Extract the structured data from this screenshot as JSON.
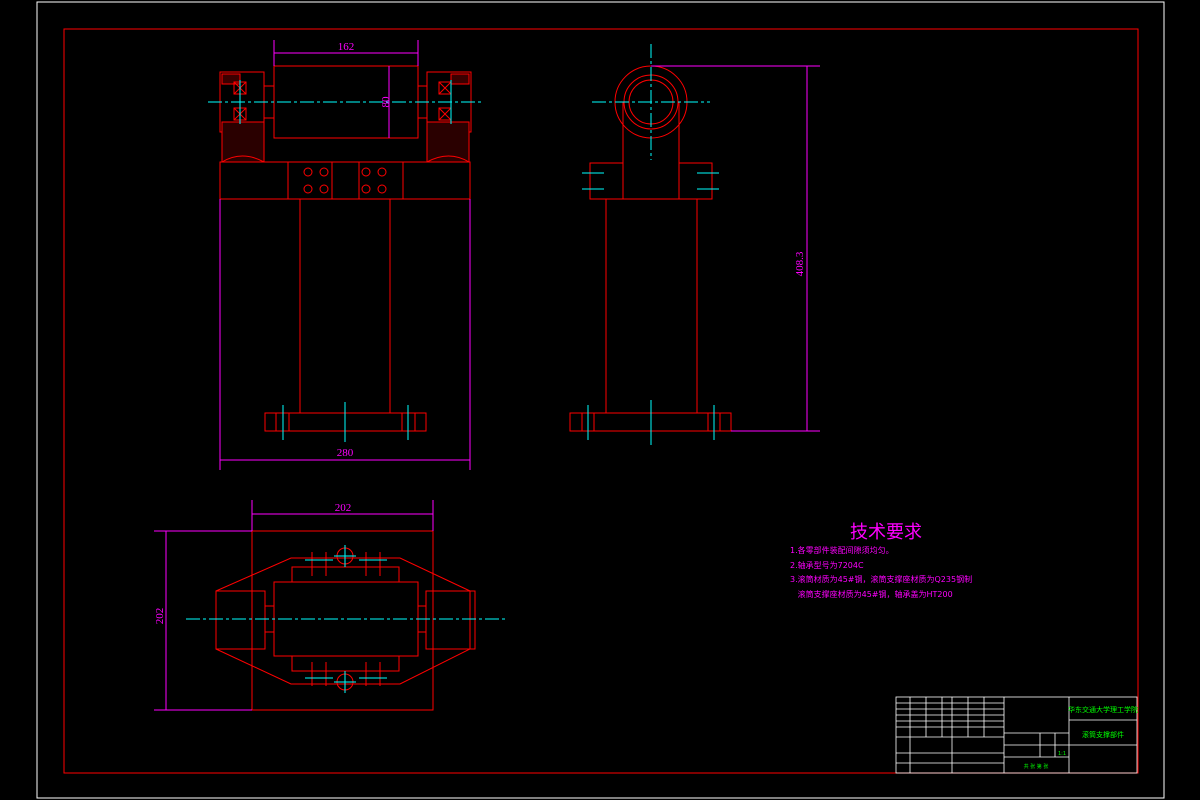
{
  "colors": {
    "background": "#000000",
    "outline": "#ff0000",
    "centerline": "#00ffff",
    "dimension": "#ff00ff",
    "frame": "#ffffff",
    "titleblock_text": "#00ff00"
  },
  "dimensions": {
    "front_top_width": "162",
    "front_bore": "80",
    "front_base_width": "280",
    "side_height": "408.3",
    "plan_width": "202",
    "plan_depth": "202"
  },
  "technical_requirements": {
    "title": "技术要求",
    "items": [
      "1.各零部件装配间隙须均匀。",
      "2.轴承型号为7204C",
      "3.滚筒材质为45#钢，滚筒支撑座材质为Q235钢制",
      "   滚筒支撑座材质为45#钢，轴承盖为HT200"
    ]
  },
  "title_block": {
    "school": "华东交通大学理工学院",
    "drawing_name": "滚筒支撑部件",
    "scale": "1:1",
    "sheet": "共 张 第 张"
  }
}
